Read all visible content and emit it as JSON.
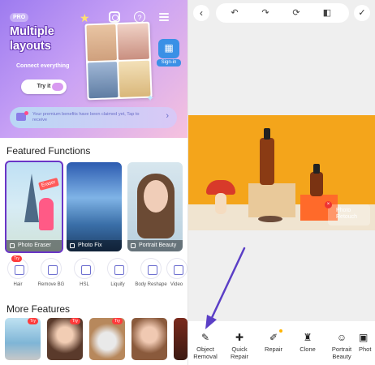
{
  "left_panel": {
    "pro_badge": "PRO",
    "hero": {
      "title": "Multiple layouts",
      "subtitle": "Connect everything",
      "try_button": "Try it",
      "sign_in": "Sign-in"
    },
    "premium_notice": "Your premium benefits have been claimed yet, Tap to receive",
    "featured_title": "Featured Functions",
    "featured_cards": [
      {
        "label": "Photo Eraser",
        "tag": "Eraser"
      },
      {
        "label": "Photo Fix"
      },
      {
        "label": "Portrait Beauty"
      }
    ],
    "tools": [
      {
        "label": "Hair",
        "tag": "Try"
      },
      {
        "label": "Remove BG"
      },
      {
        "label": "HSL"
      },
      {
        "label": "Liquify"
      },
      {
        "label": "Body Reshape"
      },
      {
        "label": "Video"
      }
    ],
    "more_title": "More Features",
    "more_tag": "Try"
  },
  "right_panel": {
    "watermark": "Photo Retouch",
    "bottom_tools": [
      {
        "label": "Object Removal"
      },
      {
        "label": "Quick Repair"
      },
      {
        "label": "Repair"
      },
      {
        "label": "Clone"
      },
      {
        "label": "Portrait Beauty"
      },
      {
        "label": "Phot"
      }
    ]
  },
  "colors": {
    "accent_purple": "#6a35c6",
    "hero_gradient_start": "#9d7bf0",
    "photo_background": "#f4a51b",
    "tag_red": "#ff3b3b"
  },
  "icons": [
    "back-icon",
    "undo-icon",
    "redo-icon",
    "reset-icon",
    "compare-icon",
    "apply-icon",
    "instagram-icon",
    "help-icon",
    "menu-icon"
  ]
}
